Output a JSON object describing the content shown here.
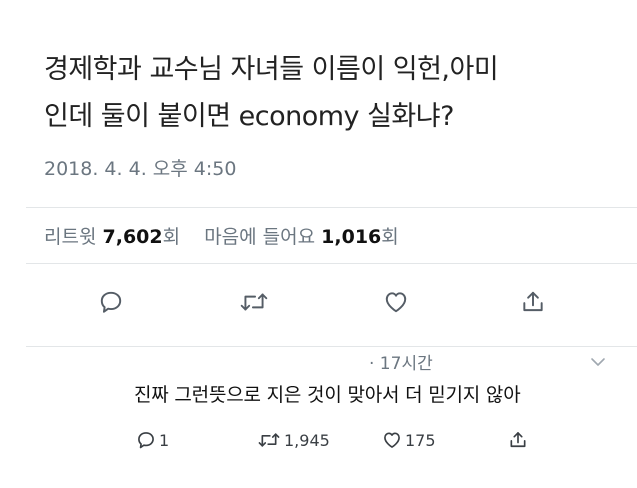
{
  "tweet": {
    "text_line1": "경제학과 교수님 자녀들 이름이 익헌,아미",
    "text_line2": "인데 둘이 붙이면 economy 실화냐?",
    "timestamp": "2018. 4. 4. 오후 4:50"
  },
  "stats": {
    "retweet_label": "리트윗",
    "retweet_count": "7,602",
    "retweet_unit": "회",
    "like_label": "마음에 들어요",
    "like_count": "1,016",
    "like_unit": "회"
  },
  "actions": {
    "icons": [
      "reply-icon",
      "retweet-icon",
      "heart-icon",
      "share-icon"
    ]
  },
  "reply": {
    "time": "· 17시간",
    "text": "진짜 그런뜻으로 지은 것이 맞아서 더 믿기지 않아",
    "reply_count": "1",
    "retweet_count": "1,945",
    "like_count": "175"
  },
  "colors": {
    "text": "#222222",
    "muted": "#6b7680",
    "icon": "#657786",
    "divider": "#e3e6e8"
  }
}
